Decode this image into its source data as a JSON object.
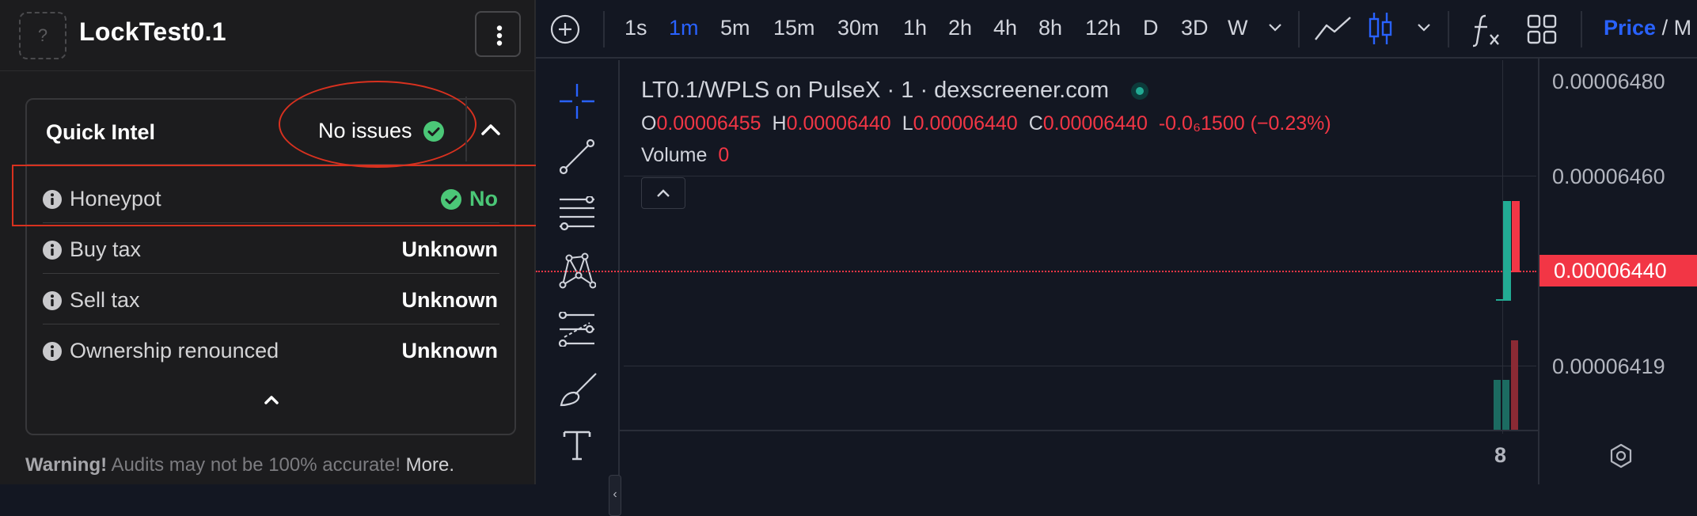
{
  "panel": {
    "token_logo_glyph": "?",
    "token_name": "LockTest0.1",
    "quick_intel": {
      "title": "Quick Intel",
      "status": "No issues",
      "rows": [
        {
          "label": "Honeypot",
          "value": "No"
        },
        {
          "label": "Buy tax",
          "value": "Unknown"
        },
        {
          "label": "Sell tax",
          "value": "Unknown"
        },
        {
          "label": "Ownership renounced",
          "value": "Unknown"
        }
      ]
    },
    "warning": {
      "strong": "Warning!",
      "text": " Audits may not be 100% accurate! ",
      "more": "More."
    }
  },
  "toolbar": {
    "intervals": [
      "1s",
      "1m",
      "5m",
      "15m",
      "30m",
      "1h",
      "2h",
      "4h",
      "8h",
      "12h",
      "D",
      "3D",
      "W"
    ],
    "active_interval": "1m",
    "price_label": "Price",
    "price_suffix": " / M"
  },
  "chart": {
    "symbol_title": "LT0.1/WPLS on PulseX · 1 · dexscreener.com",
    "ohlc": {
      "o_label": "O",
      "o": "0.00006455",
      "h_label": "H",
      "h": "0.00006440",
      "l_label": "L",
      "l": "0.00006440",
      "c_label": "C",
      "c": "0.00006440",
      "change": "-0.0₆1500 (−0.23%)"
    },
    "volume_label": "Volume",
    "volume_value": "0",
    "price_axis_labels": [
      "0.00006480",
      "0.00006460",
      "0.00006419"
    ],
    "current_price": "0.00006440",
    "time_axis_label": "8",
    "colors": {
      "up": "#22ab94",
      "down": "#f23645",
      "accent": "#2962ff"
    }
  }
}
